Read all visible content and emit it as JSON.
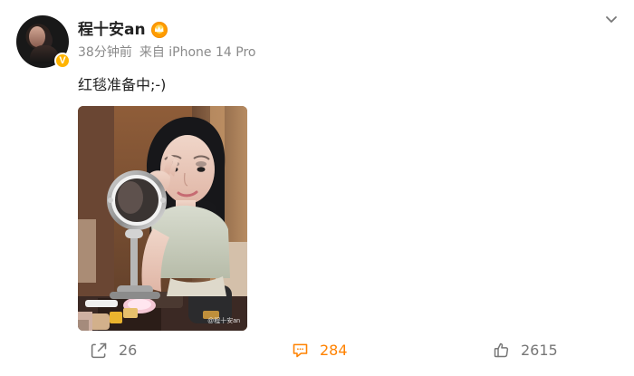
{
  "post": {
    "author": {
      "name": "程十安an",
      "verified_badge_text": "V",
      "crown_icon": "crown-badge-icon"
    },
    "meta": {
      "time": "38分钟前",
      "source": "来自 iPhone 14 Pro"
    },
    "text": "红毯准备中;-)",
    "image": {
      "watermark": "@程十安an"
    },
    "actions": {
      "repost_count": "26",
      "comment_count": "284",
      "like_count": "2615"
    }
  },
  "icons": {
    "menu": "chevron-down-icon",
    "repost": "repost-icon",
    "comment": "comment-icon",
    "like": "like-icon"
  },
  "colors": {
    "text_primary": "#222222",
    "text_secondary": "#8a8a8a",
    "accent_orange": "#ff8200",
    "verified_gold": "#ffb400"
  }
}
